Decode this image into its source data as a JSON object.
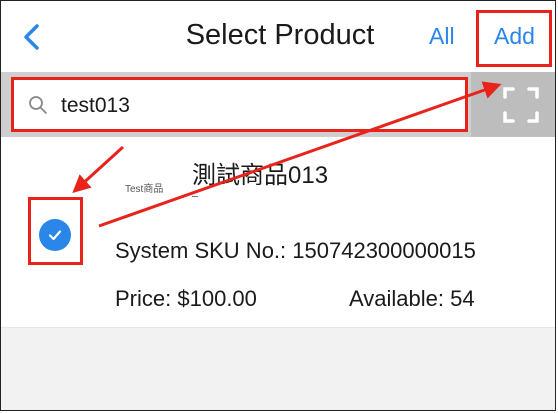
{
  "header": {
    "back_icon": "chevron-left-icon",
    "title": "Select Product",
    "all_label": "All",
    "add_label": "Add"
  },
  "search": {
    "icon": "search-icon",
    "value": "test013",
    "scan_icon": "scan-icon"
  },
  "product": {
    "thumbnail_text": "Test商品",
    "name": "測試商品013",
    "checked": true,
    "sku_label": "System SKU No.:",
    "sku_value": "150742300000015",
    "price_label": "Price:",
    "price_value": "$100.00",
    "available_label": "Available:",
    "available_value": "54"
  },
  "colors": {
    "accent": "#2a86e9",
    "annotation": "#e8231b",
    "search_strip": "#cfcfcf"
  }
}
